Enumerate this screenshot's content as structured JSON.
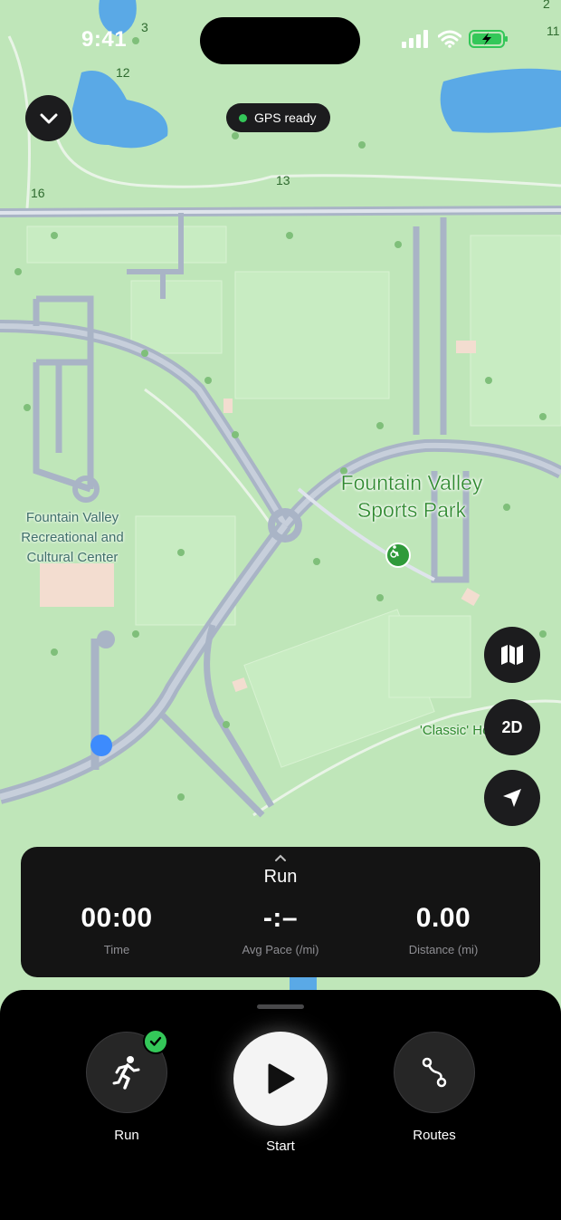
{
  "status": {
    "time": "9:41"
  },
  "header": {
    "gps_label": "GPS ready"
  },
  "map": {
    "labels": {
      "park": "Fountain Valley\nSports Park",
      "rec_center": "Fountain Valley\nRecreational and\nCultural Center",
      "classic": "'Classic' Ho",
      "n3": "3",
      "n12": "12",
      "n13": "13",
      "n16": "16",
      "n11": "11",
      "n2": "2"
    },
    "mode_button": "2D"
  },
  "stats": {
    "title": "Run",
    "time_value": "00:00",
    "time_label": "Time",
    "pace_value": "-:–",
    "pace_label": "Avg Pace (/mi)",
    "distance_value": "0.00",
    "distance_label": "Distance (mi)"
  },
  "actions": {
    "run_label": "Run",
    "start_label": "Start",
    "routes_label": "Routes"
  },
  "colors": {
    "map_green": "#bfe6b9",
    "road": "#a9b4c6",
    "water": "#5aa9e6",
    "park_text": "#2f8a2f",
    "accent_green": "#34c759",
    "location_blue": "#3d8bfd"
  }
}
